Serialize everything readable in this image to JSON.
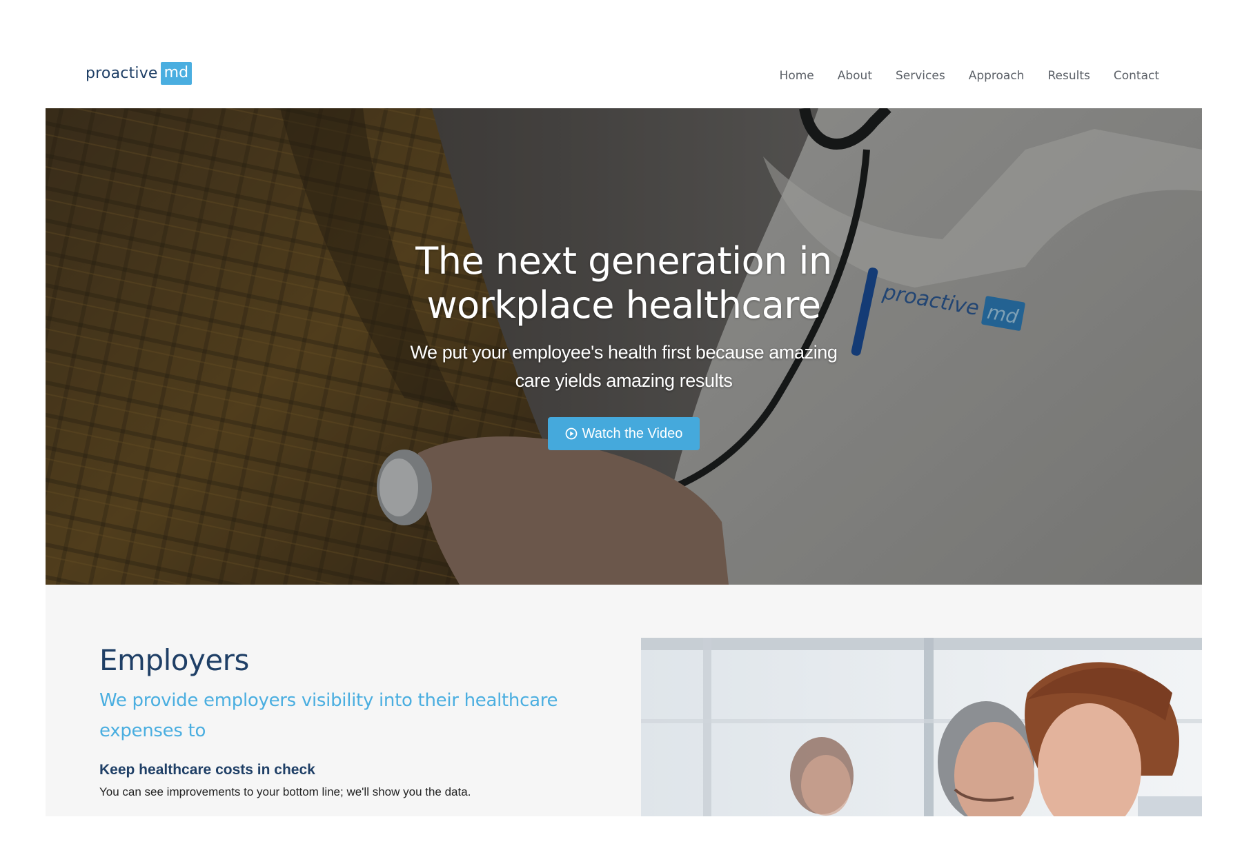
{
  "brand": {
    "word": "proactive",
    "badge": "md"
  },
  "nav": {
    "items": [
      {
        "label": "Home"
      },
      {
        "label": "About"
      },
      {
        "label": "Services"
      },
      {
        "label": "Approach"
      },
      {
        "label": "Results"
      },
      {
        "label": "Contact"
      }
    ]
  },
  "hero": {
    "title": "The next generation in workplace healthcare",
    "subtitle": "We put your employee's health first because amazing care yields amazing results",
    "button_label": "Watch the Video",
    "coat_logo_word": "proactive",
    "coat_logo_badge": "md"
  },
  "employers": {
    "title": "Employers",
    "lead": "We provide employers visibility into their healthcare expenses to",
    "point_heading": "Keep healthcare costs in check",
    "point_text": "You can see improvements to your bottom line; we'll show you the data."
  },
  "colors": {
    "brand_navy": "#1f3f66",
    "brand_blue": "#4aaee0",
    "button_blue": "#45a9dc",
    "nav_text": "#5b6067",
    "section_bg": "#f6f6f6"
  },
  "icons": {
    "video_button": "play-circle-icon"
  }
}
